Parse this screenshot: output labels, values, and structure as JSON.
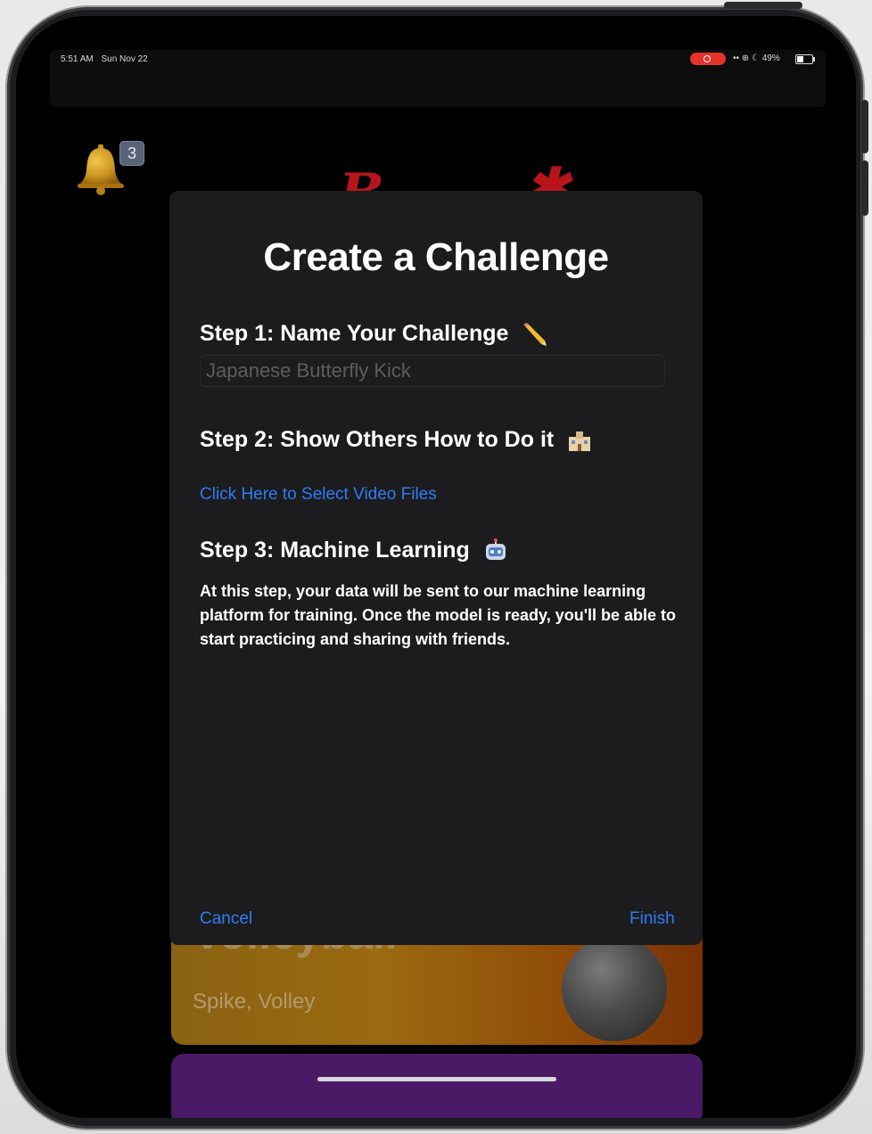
{
  "status_bar": {
    "time": "5:51 AM",
    "date": "Sun Nov 22",
    "battery": "49%",
    "recording_color": "#e5332a"
  },
  "notifications": {
    "badge_count": "3",
    "icon": "bell-icon"
  },
  "modal": {
    "title": "Create a Challenge",
    "step1": {
      "label": "Step 1: Name Your Challenge",
      "emoji": "pencil-icon",
      "placeholder": "Japanese Butterfly Kick"
    },
    "step2": {
      "label": "Step 2: Show Others How to Do it",
      "emoji": "school-icon",
      "link": "Click Here to Select Video Files"
    },
    "step3": {
      "label": "Step 3: Machine Learning",
      "emoji": "robot-icon",
      "description": "At this step, your data will be sent to our machine learning platform for training. Once the model is ready, you'll be able to start practicing and sharing with friends."
    },
    "cancel_label": "Cancel",
    "finish_label": "Finish",
    "link_color": "#2f7cf6"
  },
  "background_cards": [
    {
      "title": "Volleyball",
      "subtitle": "Spike, Volley",
      "icon": "volleyball-icon"
    }
  ]
}
